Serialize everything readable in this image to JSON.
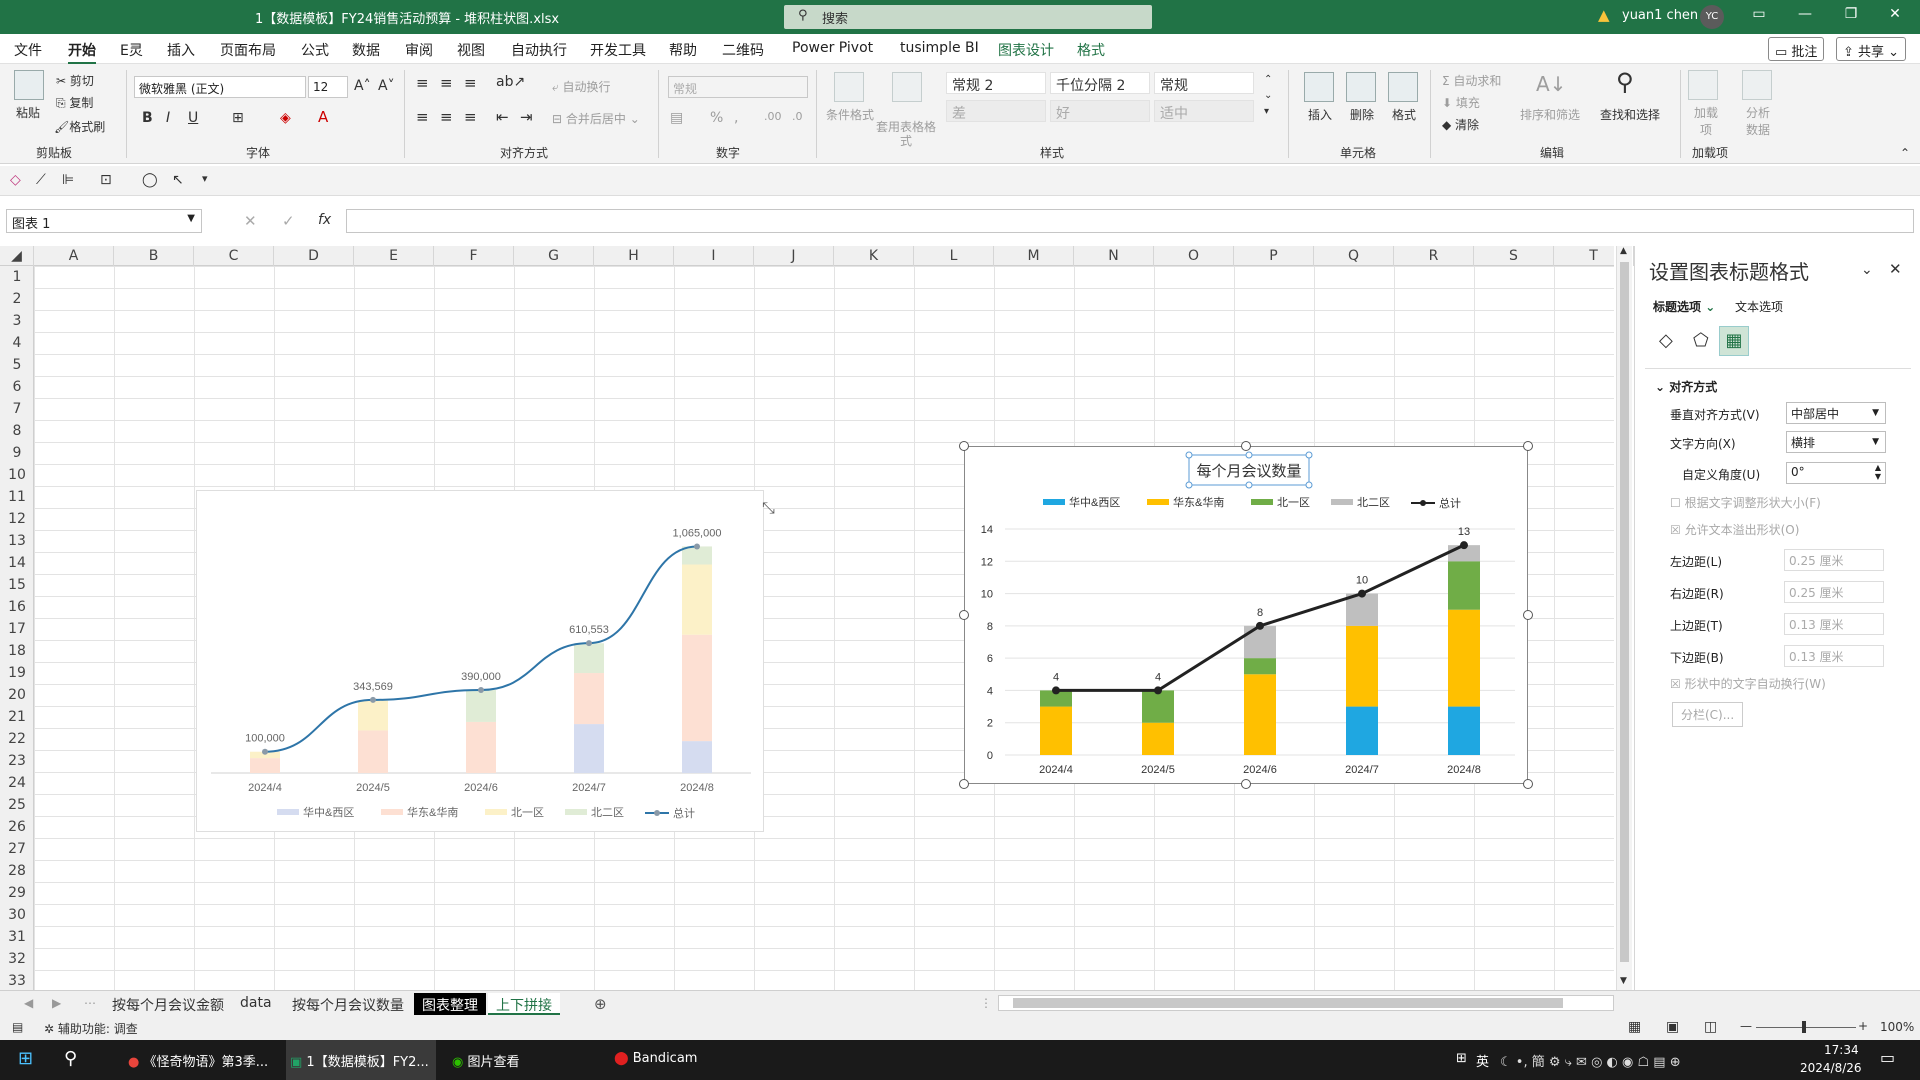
{
  "titlebar": {
    "file_title": "1【数据模板】FY24销售活动预算 - 堆积柱状图.xlsx",
    "search_placeholder": "搜索",
    "user": "yuan1 chen",
    "avatar": "YC"
  },
  "menu": {
    "tabs": [
      "文件",
      "开始",
      "E灵",
      "插入",
      "页面布局",
      "公式",
      "数据",
      "审阅",
      "视图",
      "自动执行",
      "开发工具",
      "帮助",
      "二维码",
      "Power Pivot",
      "tusimple BI",
      "图表设计",
      "格式"
    ],
    "comment_btn": "批注",
    "share_btn": "共享"
  },
  "ribbon": {
    "clipboard": {
      "paste": "粘贴",
      "cut": "剪切",
      "copy": "复制",
      "format_painter": "格式刷",
      "label": "剪贴板"
    },
    "font": {
      "name": "微软雅黑 (正文)",
      "size": "12",
      "label": "字体"
    },
    "align": {
      "wrap": "自动换行",
      "merge": "合并后居中",
      "label": "对齐方式"
    },
    "number": {
      "format": "常规",
      "label": "数字"
    },
    "styles": {
      "cond": "条件格式",
      "table": "套用表格格式",
      "cells": [
        "常规 2",
        "千位分隔 2",
        "常规",
        "差",
        "好",
        "适中"
      ],
      "label": "样式"
    },
    "cells": {
      "insert": "插入",
      "delete": "删除",
      "format": "格式",
      "label": "单元格"
    },
    "edit": {
      "autosum": "自动求和",
      "fill": "填充",
      "clear": "清除",
      "sort": "排序和筛选",
      "find": "查找和选择",
      "label": "编辑"
    },
    "addins": {
      "addin": "加载项",
      "label": "加载项",
      "analyze": "分析数据"
    }
  },
  "formula": {
    "namebox": "图表 1",
    "fx": "fx"
  },
  "columns": [
    "A",
    "B",
    "C",
    "D",
    "E",
    "F",
    "G",
    "H",
    "I",
    "J",
    "K",
    "L",
    "M",
    "N",
    "O",
    "P",
    "Q",
    "R",
    "S",
    "T"
  ],
  "rows": [
    "1",
    "2",
    "3",
    "4",
    "5",
    "6",
    "7",
    "8",
    "9",
    "10",
    "11",
    "12",
    "13",
    "14",
    "15",
    "16",
    "17",
    "18",
    "19",
    "20",
    "21",
    "22",
    "23",
    "24",
    "25",
    "26",
    "27",
    "28",
    "29",
    "30",
    "31",
    "32",
    "33"
  ],
  "sheets": [
    "按每个月会议金额",
    "data",
    "按每个月会议数量",
    "图表整理",
    "上下拼接"
  ],
  "status": {
    "accessibility": "辅助功能: 调查",
    "zoom": "100%"
  },
  "pane": {
    "title": "设置图表标题格式",
    "tab1": "标题选项",
    "tab2": "文本选项",
    "section": "对齐方式",
    "valign_label": "垂直对齐方式(V)",
    "valign_value": "中部居中",
    "dir_label": "文字方向(X)",
    "dir_value": "横排",
    "angle_label": "自定义角度(U)",
    "angle_value": "0°",
    "autofit": "根据文字调整形状大小(F)",
    "overflow": "允许文本溢出形状(O)",
    "left_label": "左边距(L)",
    "left_value": "0.25 厘米",
    "right_label": "右边距(R)",
    "right_value": "0.25 厘米",
    "top_label": "上边距(T)",
    "top_value": "0.13 厘米",
    "bottom_label": "下边距(B)",
    "bottom_value": "0.13 厘米",
    "wrap": "形状中的文字自动换行(W)",
    "columns": "分栏(C)..."
  },
  "taskbar": {
    "items": [
      "《怪奇物语》第3季...",
      "1【数据模板】FY2...",
      "图片查看",
      "Bandicam"
    ],
    "tray": "英",
    "time": "17:34",
    "date": "2024/8/26"
  },
  "colors": {
    "excel_green": "#217346",
    "s1": "#1fa7e1",
    "s2": "#ffc000",
    "s3": "#70ad47",
    "s4": "#bfbfbf",
    "line": "#222222"
  },
  "chart_data": [
    {
      "type": "bar",
      "stacked": true,
      "title": "",
      "categories": [
        "2024/4",
        "2024/5",
        "2024/6",
        "2024/7",
        "2024/8"
      ],
      "series": [
        {
          "name": "华中&西区",
          "values": [
            0,
            0,
            0,
            230000,
            150000
          ]
        },
        {
          "name": "华东&华南",
          "values": [
            70000,
            200000,
            240000,
            240000,
            500000
          ]
        },
        {
          "name": "北一区",
          "values": [
            30000,
            140000,
            0,
            0,
            330000
          ]
        },
        {
          "name": "北二区",
          "values": [
            0,
            0,
            150000,
            140000,
            85000
          ]
        }
      ],
      "line": {
        "name": "总计",
        "values": [
          100000,
          343569,
          390000,
          610553,
          1065000
        ],
        "labels": [
          "100,000",
          "343,569",
          "390,000",
          "610,553",
          "1,065,000"
        ]
      },
      "legend": "bottom",
      "faded": true
    },
    {
      "type": "bar",
      "stacked": true,
      "title": "每个月会议数量",
      "categories": [
        "2024/4",
        "2024/5",
        "2024/6",
        "2024/7",
        "2024/8"
      ],
      "series": [
        {
          "name": "华中&西区",
          "values": [
            0,
            0,
            0,
            3,
            3
          ]
        },
        {
          "name": "华东&华南",
          "values": [
            3,
            2,
            5,
            5,
            6
          ]
        },
        {
          "name": "北一区",
          "values": [
            1,
            2,
            1,
            0,
            3
          ]
        },
        {
          "name": "北二区",
          "values": [
            0,
            0,
            2,
            2,
            1
          ]
        }
      ],
      "line": {
        "name": "总计",
        "values": [
          4,
          4,
          8,
          10,
          13
        ],
        "labels": [
          "4",
          "4",
          "8",
          "10",
          "13"
        ]
      },
      "ylim": [
        0,
        14
      ],
      "yticks": [
        "0",
        "2",
        "4",
        "6",
        "8",
        "10",
        "12",
        "14"
      ],
      "legend": "top"
    }
  ]
}
